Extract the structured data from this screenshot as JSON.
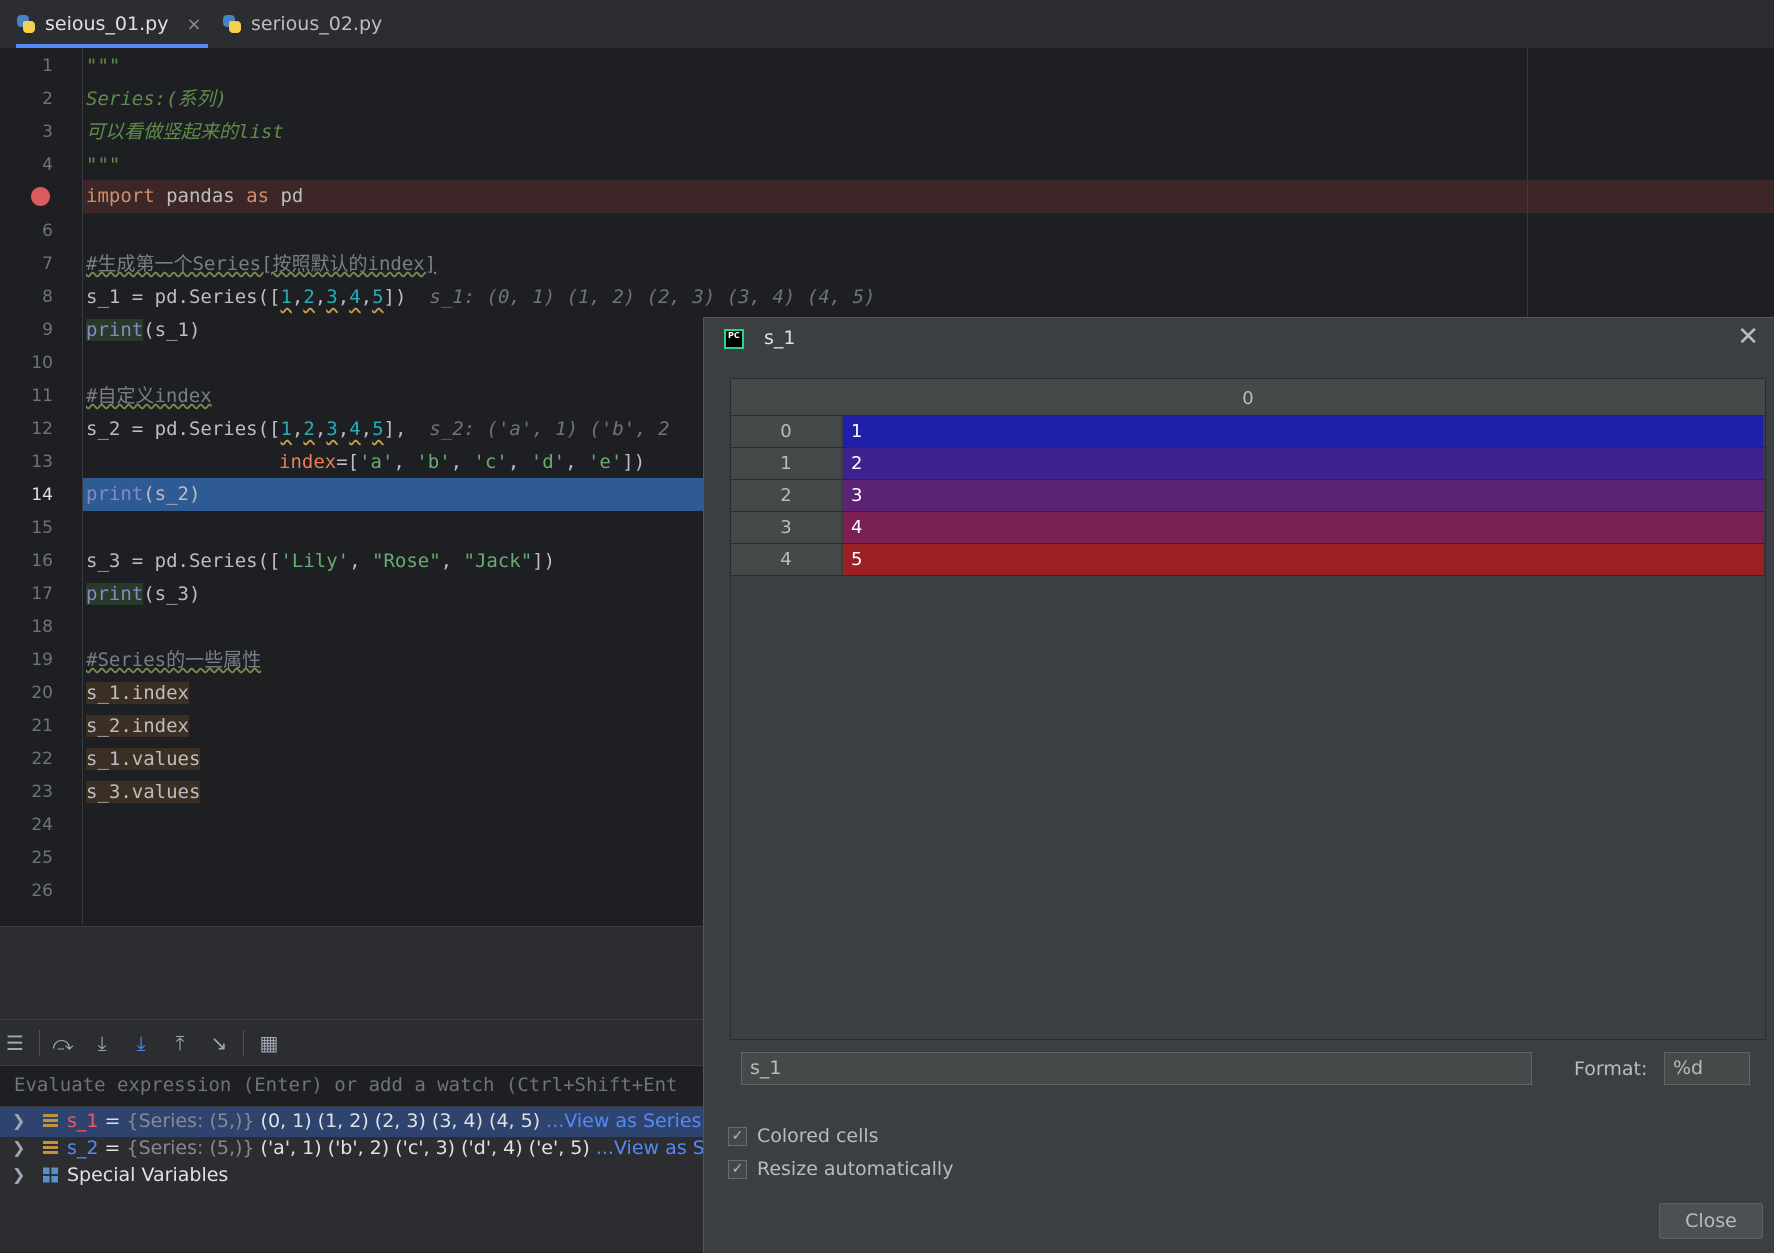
{
  "tabs": [
    {
      "label": "seious_01.py",
      "active": true,
      "close": "×"
    },
    {
      "label": "serious_02.py",
      "active": false
    }
  ],
  "editor": {
    "line_numbers": [
      "1",
      "2",
      "3",
      "4",
      "5",
      "6",
      "7",
      "8",
      "9",
      "10",
      "11",
      "12",
      "13",
      "14",
      "15",
      "16",
      "17",
      "18",
      "19",
      "20",
      "21",
      "22",
      "23",
      "24",
      "25",
      "26"
    ],
    "current_line": "14",
    "breakpoint_line": "5",
    "lines": {
      "l1": "\"\"\"",
      "l2": "Series:(系列)",
      "l3": "可以看做竖起来的list",
      "l4": "\"\"\"",
      "l5_kw1": "import",
      "l5_mod": " pandas ",
      "l5_kw2": "as",
      "l5_alias": " pd",
      "l7": "#生成第一个Series[按照默认的index]",
      "l8_pre": "s_1 = pd.Series([",
      "l8_nums": [
        "1",
        "2",
        "3",
        "4",
        "5"
      ],
      "l8_post": "])",
      "l8_hint": "s_1: (0, 1) (1, 2) (2, 3) (3, 4) (4, 5)",
      "l9_fn": "print",
      "l9_args": "(s_1)",
      "l11": "#自定义index",
      "l12_pre": "s_2 = pd.Series([",
      "l12_nums": [
        "1",
        "2",
        "3",
        "4",
        "5"
      ],
      "l12_post": "],",
      "l12_hint": "s_2: ('a', 1) ('b', 2",
      "l13_param": "index",
      "l13_eq": "=[",
      "l13_strs": [
        "'a'",
        "'b'",
        "'c'",
        "'d'",
        "'e'"
      ],
      "l13_post": "])",
      "l14_fn": "print",
      "l14_args": "(s_2)",
      "l16_pre": "s_3 = pd.Series([",
      "l16_strs": [
        "'Lily'",
        "\"Rose\"",
        "\"Jack\""
      ],
      "l16_post": "])",
      "l17_fn": "print",
      "l17_args": "(s_3)",
      "l19": "#Series的一些属性",
      "l20": "s_1.index",
      "l21": "s_2.index",
      "l22": "s_1.values",
      "l23": "s_3.values"
    }
  },
  "debug": {
    "toolbar_icons": [
      "menu-icon",
      "step-over-icon",
      "step-into-icon",
      "step-into-my-code-icon",
      "step-out-icon",
      "run-to-cursor-icon",
      "evaluate-icon"
    ],
    "eval_placeholder": "Evaluate expression (Enter) or add a watch (Ctrl+Shift+Ent",
    "variables": [
      {
        "name": "s_1",
        "eq": " = ",
        "type": "{Series: (5,)} ",
        "value": "(0, 1) (1, 2) (2, 3) (3, 4) (4, 5) ",
        "link": "...View as Series",
        "selected": true
      },
      {
        "name": "s_2",
        "eq": " = ",
        "type": "{Series: (5,)} ",
        "value": "('a', 1) ('b', 2) ('c', 3) ('d', 4) ('e', 5) ",
        "link": "...View as Series",
        "selected": false
      },
      {
        "name": "Special Variables",
        "selected": false
      }
    ]
  },
  "dialog": {
    "title": "s_1",
    "column_header": "0",
    "rows": [
      {
        "index": "0",
        "value": "1",
        "color": "#1f1fa8"
      },
      {
        "index": "1",
        "value": "2",
        "color": "#3d2290"
      },
      {
        "index": "2",
        "value": "3",
        "color": "#5c2274"
      },
      {
        "index": "3",
        "value": "4",
        "color": "#7b2052"
      },
      {
        "index": "4",
        "value": "5",
        "color": "#9c1f23"
      }
    ],
    "expression": "s_1",
    "format_label": "Format:",
    "format_value": "%d",
    "colored_cells_label": "Colored cells",
    "colored_cells": true,
    "resize_label": "Resize automatically",
    "resize": true,
    "close_label": "Close"
  },
  "colors": {
    "accent": "#548af7",
    "breakpoint": "#db5c5c",
    "selection": "#2e5b94"
  }
}
